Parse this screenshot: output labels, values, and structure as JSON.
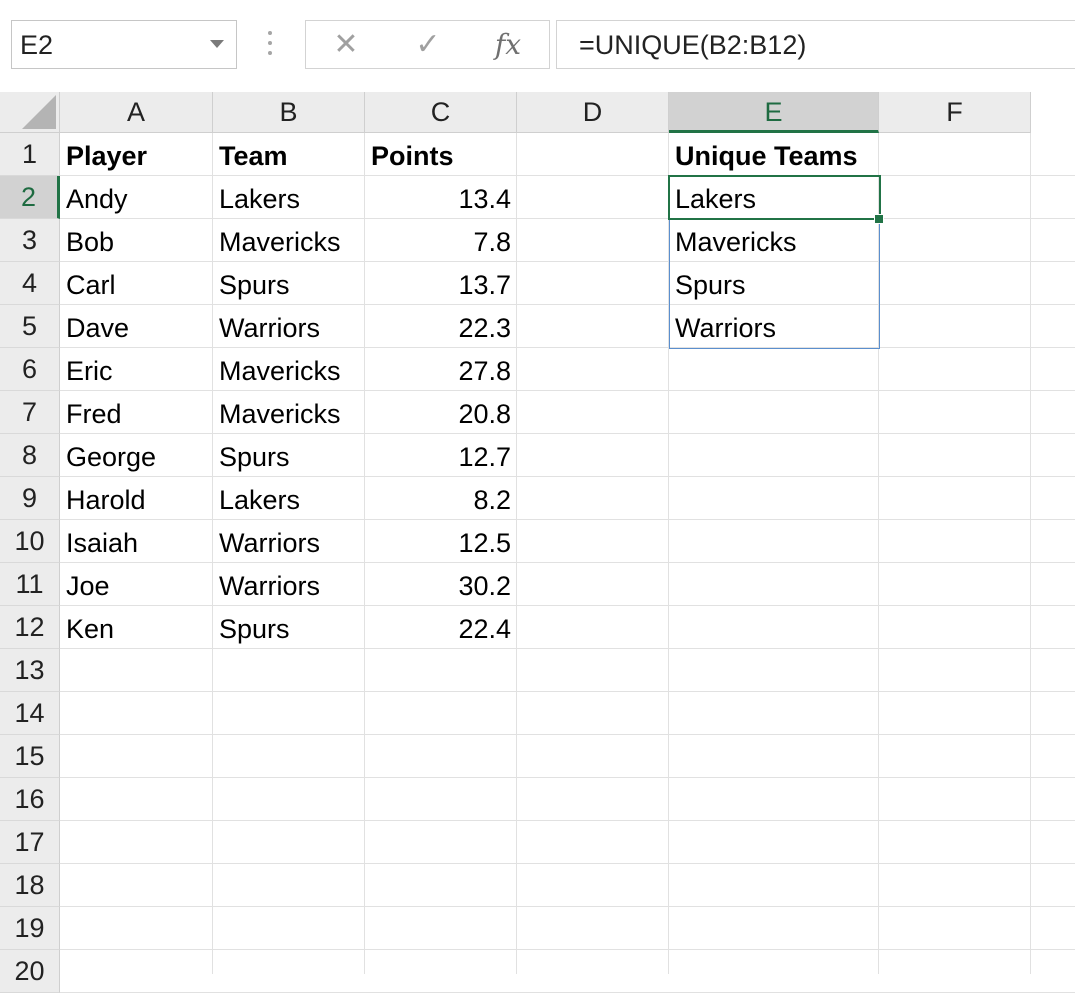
{
  "formula_bar": {
    "name_box": "E2",
    "cancel_icon": "close-icon",
    "enter_icon": "checkmark-icon",
    "function_label": "fx",
    "formula": "=UNIQUE(B2:B12)"
  },
  "selected_cell": "E2",
  "columns": [
    "A",
    "B",
    "C",
    "D",
    "E",
    "F"
  ],
  "rows": [
    "1",
    "2",
    "3",
    "4",
    "5",
    "6",
    "7",
    "8",
    "9",
    "10",
    "11",
    "12",
    "13",
    "14",
    "15",
    "16",
    "17",
    "18",
    "19",
    "20"
  ],
  "table": {
    "headers": [
      "Player",
      "Team",
      "Points"
    ],
    "records": [
      [
        "Andy",
        "Lakers",
        "13.4"
      ],
      [
        "Bob",
        "Mavericks",
        "7.8"
      ],
      [
        "Carl",
        "Spurs",
        "13.7"
      ],
      [
        "Dave",
        "Warriors",
        "22.3"
      ],
      [
        "Eric",
        "Mavericks",
        "27.8"
      ],
      [
        "Fred",
        "Mavericks",
        "20.8"
      ],
      [
        "George",
        "Spurs",
        "12.7"
      ],
      [
        "Harold",
        "Lakers",
        "8.2"
      ],
      [
        "Isaiah",
        "Warriors",
        "12.5"
      ],
      [
        "Joe",
        "Warriors",
        "30.2"
      ],
      [
        "Ken",
        "Spurs",
        "22.4"
      ]
    ]
  },
  "unique": {
    "header": "Unique Teams",
    "values": [
      "Lakers",
      "Mavericks",
      "Spurs",
      "Warriors"
    ]
  },
  "colors": {
    "selection": "#217346",
    "spill_border": "#5b8fce",
    "header_bg": "#ececec"
  }
}
